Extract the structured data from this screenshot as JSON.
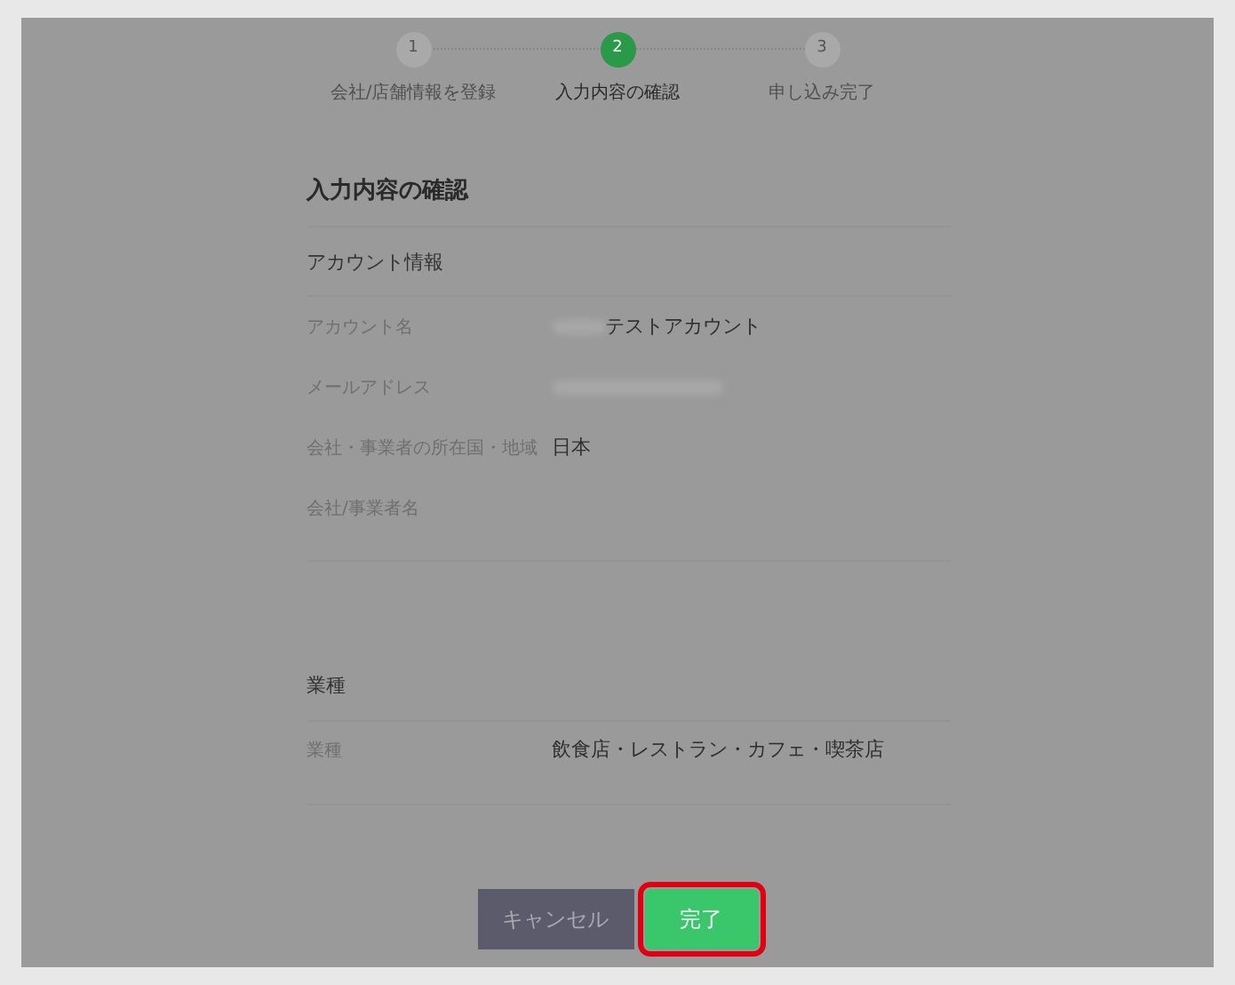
{
  "steps": [
    {
      "number": "1",
      "label": "会社/店舗情報を登録",
      "selected": false
    },
    {
      "number": "2",
      "label": "入力内容の確認",
      "selected": true
    },
    {
      "number": "3",
      "label": "申し込み完了",
      "selected": false
    }
  ],
  "title": "入力内容の確認",
  "sections": [
    {
      "heading": "アカウント情報",
      "rows": [
        {
          "label": "アカウント名",
          "kind": "partly_blurred",
          "value": "テストアカウント"
        },
        {
          "label": "メールアドレス",
          "kind": "blurred"
        },
        {
          "label": "会社・事業者の所在国・地域",
          "kind": "text",
          "value": "日本"
        },
        {
          "label": "会社/事業者名",
          "kind": "empty"
        }
      ]
    },
    {
      "heading": "業種",
      "rows": [
        {
          "label": "業種",
          "kind": "text",
          "value": "飲食店・レストラン・カフェ・喫茶店"
        }
      ]
    }
  ],
  "buttons": [
    {
      "label": "キャンセル",
      "kind": "secondary",
      "highlighted": false
    },
    {
      "label": "完了",
      "kind": "primary",
      "highlighted": true
    }
  ]
}
